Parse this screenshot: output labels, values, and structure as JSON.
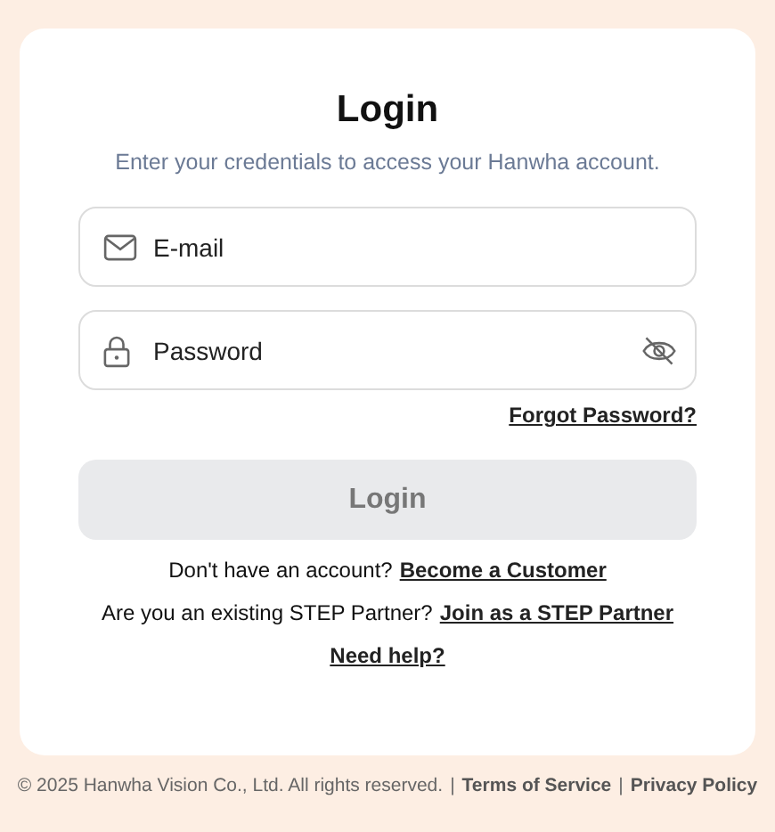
{
  "title": "Login",
  "subtitle": "Enter your credentials to access your Hanwha account.",
  "fields": [
    {
      "kind": "email",
      "placeholder": "E-mail"
    },
    {
      "kind": "password",
      "placeholder": "Password",
      "password_visible": false
    }
  ],
  "forgot_link": "Forgot Password?",
  "login_button": {
    "label": "Login",
    "disabled": true
  },
  "prompts": [
    {
      "text": "Don't have an account?",
      "link": "Become a Customer"
    },
    {
      "text": "Are you an existing STEP Partner?",
      "link": "Join as a STEP Partner"
    }
  ],
  "help_link": "Need help?",
  "footer": {
    "copyright": "© 2025 Hanwha Vision Co., Ltd. All rights reserved.",
    "links": [
      {
        "separator": "|",
        "label": "Terms of Service"
      },
      {
        "separator": "|",
        "label": "Privacy Policy"
      }
    ]
  }
}
